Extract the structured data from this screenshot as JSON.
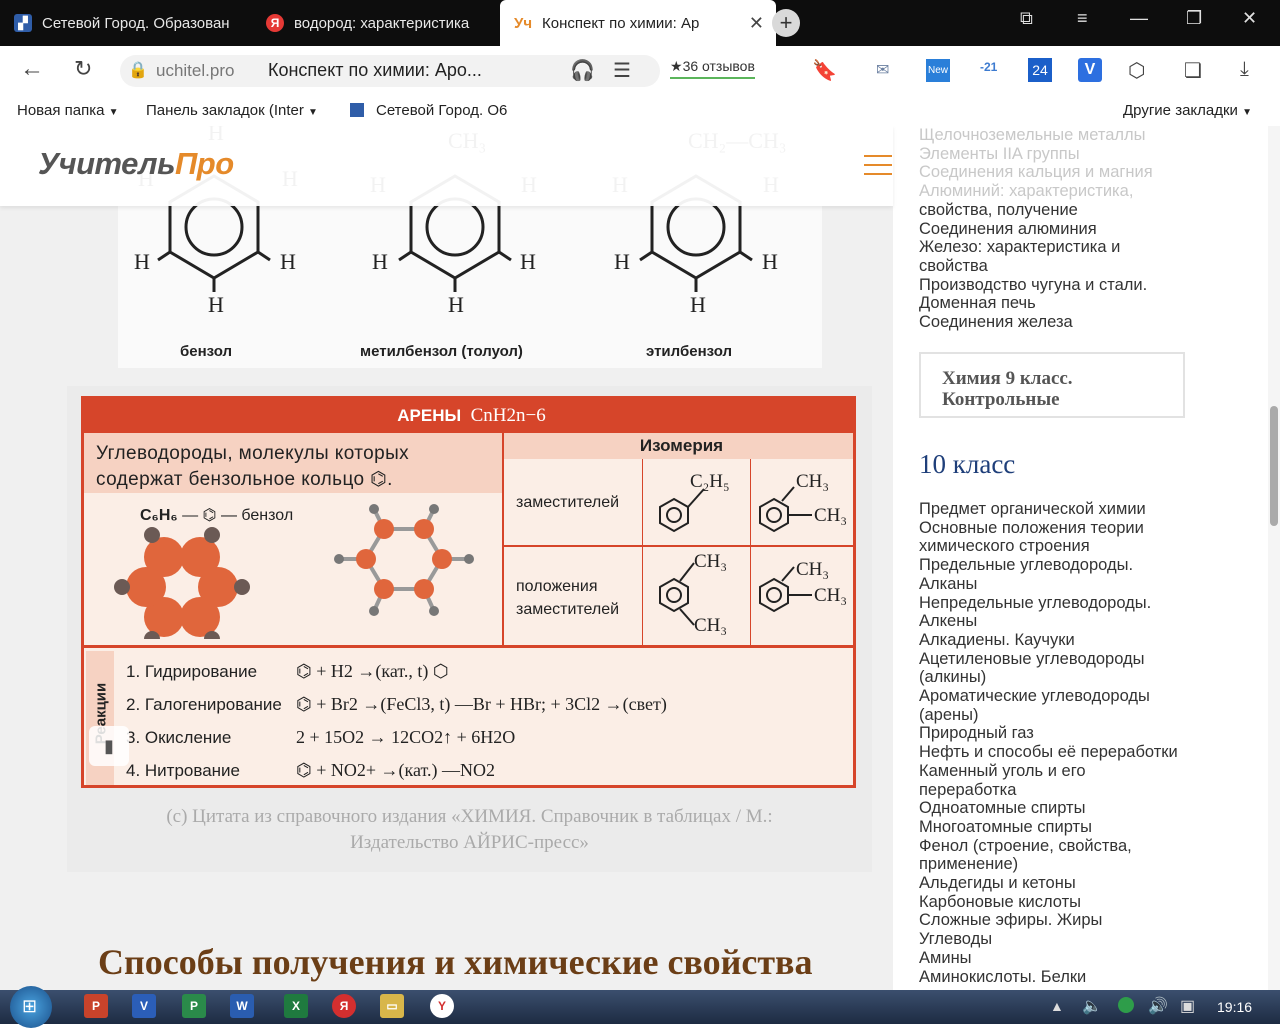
{
  "browser": {
    "tabs": [
      {
        "title": "Сетевой Город. Образован"
      },
      {
        "title": "водород: характеристика"
      },
      {
        "title": "Конспект по химии: Ар"
      }
    ],
    "url_domain": "uchitel.pro",
    "page_title": "Конспект по химии: Аро...",
    "reviews": "36 отзывов",
    "ext_new": "New",
    "ext_21": "-21",
    "ext_24": "24",
    "ext_v": "V",
    "bookmarks": [
      {
        "label": "Новая папка"
      },
      {
        "label": "Панель закладок (Inter"
      },
      {
        "label": "Сетевой Город. О6"
      }
    ],
    "other_bookmarks": "Другие закладки"
  },
  "site": {
    "logo_part1": "Учитель",
    "logo_part2": "Про"
  },
  "article": {
    "figure1": {
      "labels": [
        "бензол",
        "метилбензол (толуол)",
        "этилбензол"
      ]
    },
    "figure2": {
      "header": "АРЕНЫ",
      "formula": "CnH2n−6",
      "definition_line1": "Углеводороды, молекулы которых",
      "definition_line2": "содержат бензольное кольцо",
      "benzene_label": "— бензол",
      "isomerism_header": "Изомерия",
      "isomer_row1": "заместителей",
      "isomer_row2_line1": "положения",
      "isomer_row2_line2": "заместителей",
      "reactions_label": "Реакции",
      "reactions": [
        {
          "name": "1. Гидрирование",
          "equation": "+ H2 →(кат., t)"
        },
        {
          "name": "2. Галогенирование",
          "equation": "+ Br2 →(FeCl3, t) —Br + HBr;  + 3Cl2 →(свет)"
        },
        {
          "name": "3. Окисление",
          "equation": "2 + 15O2 → 12CO2↑ + 6H2O"
        },
        {
          "name": "4. Нитрование",
          "equation": "+ NO2+ →(кат.) —NO2"
        }
      ]
    },
    "caption_line1": "(с) Цитата из справочного издания «ХИМИЯ. Справочник в таблицах / М.:",
    "caption_line2": "Издательство АЙРИС-пресс»",
    "heading": "Способы получения и химические свойства"
  },
  "sidebar": {
    "links_top": [
      "Щелочноземельные металлы",
      "Элементы IIA группы",
      "Соединения кальция и магния",
      "Алюминий: характеристика,",
      "свойства, получение",
      "Соединения алюминия",
      "Железо: характеристика и",
      "свойства",
      "Производство чугуна и стали.",
      "Доменная печь",
      "Соединения железа"
    ],
    "box_title_line1": "Химия 9 класс.",
    "box_title_line2": "Контрольные",
    "section_title": "10 класс",
    "links": [
      "Предмет органической химии",
      "Основные положения теории",
      "химического строения",
      "Предельные углеводороды.",
      "Алканы",
      "Непредельные углеводороды.",
      "Алкены",
      "Алкадиены. Каучуки",
      "Ацетиленовые углеводороды",
      "(алкины)",
      "Ароматические углеводороды",
      "(арены)",
      "Природный газ",
      "Нефть и способы её переработки",
      "Каменный уголь и его",
      "переработка",
      "Одноатомные спирты",
      "Многоатомные спирты",
      "Фенол (строение, свойства,",
      "применение)",
      "Альдегиды и кетоны",
      "Карбоновые кислоты",
      "Сложные эфиры. Жиры",
      "Углеводы",
      "Амины",
      "Аминокислоты. Белки"
    ]
  },
  "taskbar": {
    "time": "19:16"
  }
}
